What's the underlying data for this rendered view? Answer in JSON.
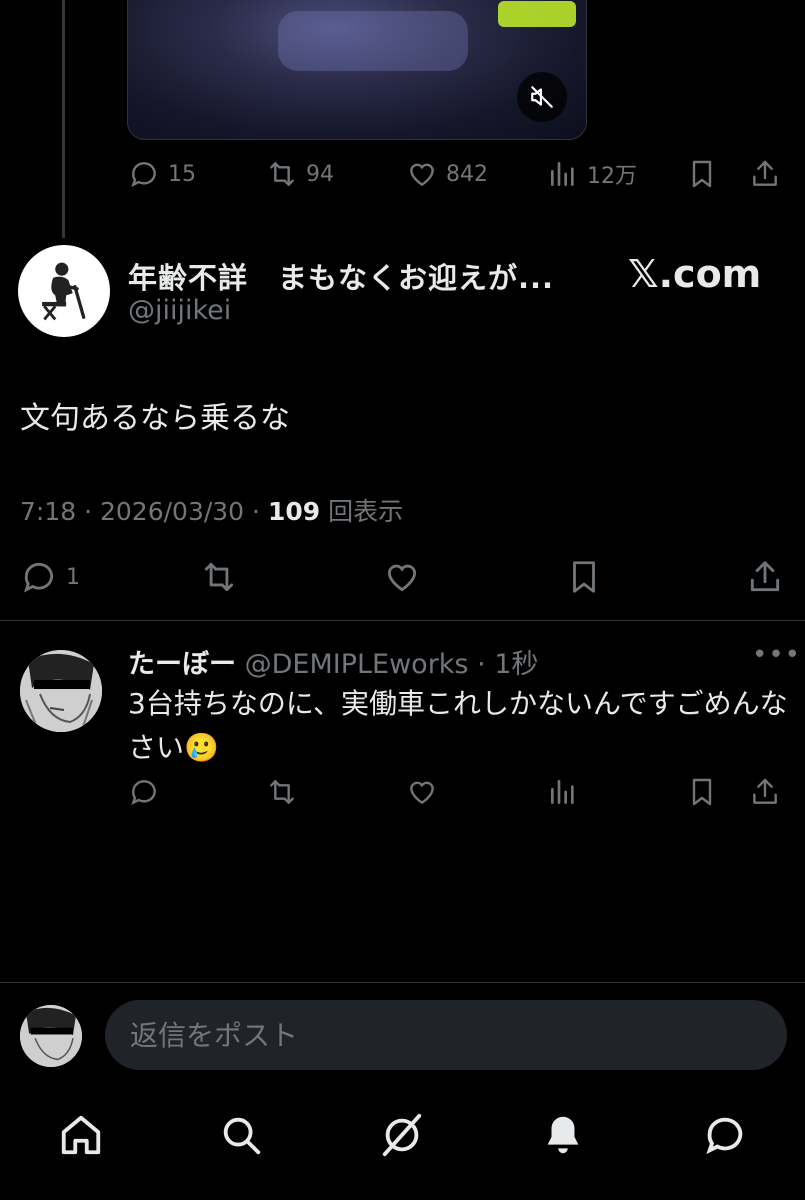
{
  "parent_tweet": {
    "actions": {
      "reply_count": "15",
      "repost_count": "94",
      "like_count": "842",
      "views_count": "12万"
    }
  },
  "main_tweet": {
    "author_name": "年齢不詳　まもなくお迎えが...",
    "author_handle": "@jiijikei",
    "watermark": "𝕏.com",
    "text": "文句あるなら乗るな",
    "time": "7:18",
    "date": "2026/03/30",
    "views": "109",
    "views_label": "回表示",
    "reply_count": "1"
  },
  "reply_tweet": {
    "author_name": "たーぼー",
    "author_handle": "@DEMIPLEworks",
    "time_ago": "1秒",
    "text": "3台持ちなのに、実働車これしかないんですごめんなさい🥲"
  },
  "composer": {
    "placeholder": "返信をポスト"
  },
  "tabbar": [
    "home-icon",
    "search-icon",
    "grok-icon",
    "notifications-icon",
    "messages-icon"
  ],
  "colors": {
    "background": "#000000",
    "text_primary": "#e7e9ea",
    "text_secondary": "#71767b",
    "divider": "#2f3336"
  }
}
